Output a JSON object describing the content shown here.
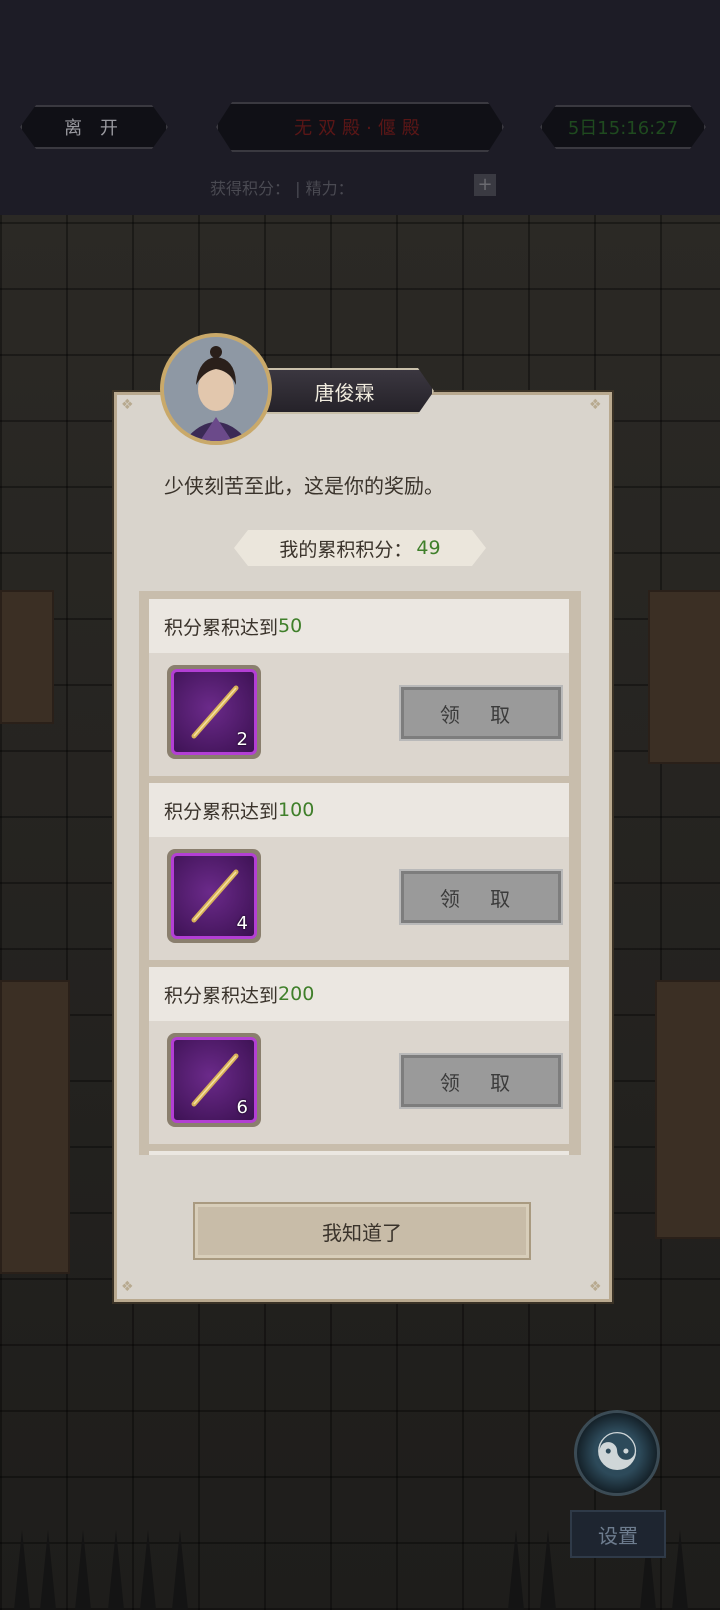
{
  "topbar": {
    "leave_label": "离 开",
    "title": "无双殿·偃殿",
    "timer": "5日15:16:27",
    "points_label": "获得积分：",
    "points_value": "",
    "energy_label": "| 精力：",
    "energy_value": "",
    "plus_label": "+"
  },
  "dialog": {
    "npc_name": "唐俊霖",
    "message": "少侠刻苦至此，这是你的奖励。",
    "score_label": "我的累积积分：",
    "score_value": "49",
    "rewards": [
      {
        "prefix": "积分累积达到",
        "threshold": "50",
        "count": "2",
        "claim_label": "领 取"
      },
      {
        "prefix": "积分累积达到",
        "threshold": "100",
        "count": "4",
        "claim_label": "领 取"
      },
      {
        "prefix": "积分累积达到",
        "threshold": "200",
        "count": "6",
        "claim_label": "领 取"
      }
    ],
    "ack_label": "我知道了"
  },
  "settings_label": "设置",
  "colors": {
    "accent_green": "#3f7f2a",
    "item_purple": "#b33fd4",
    "panel": "#d9d4cc"
  },
  "icons": {
    "reward_item": "golden-stick-icon",
    "bottom_right": "taiji-icon"
  }
}
